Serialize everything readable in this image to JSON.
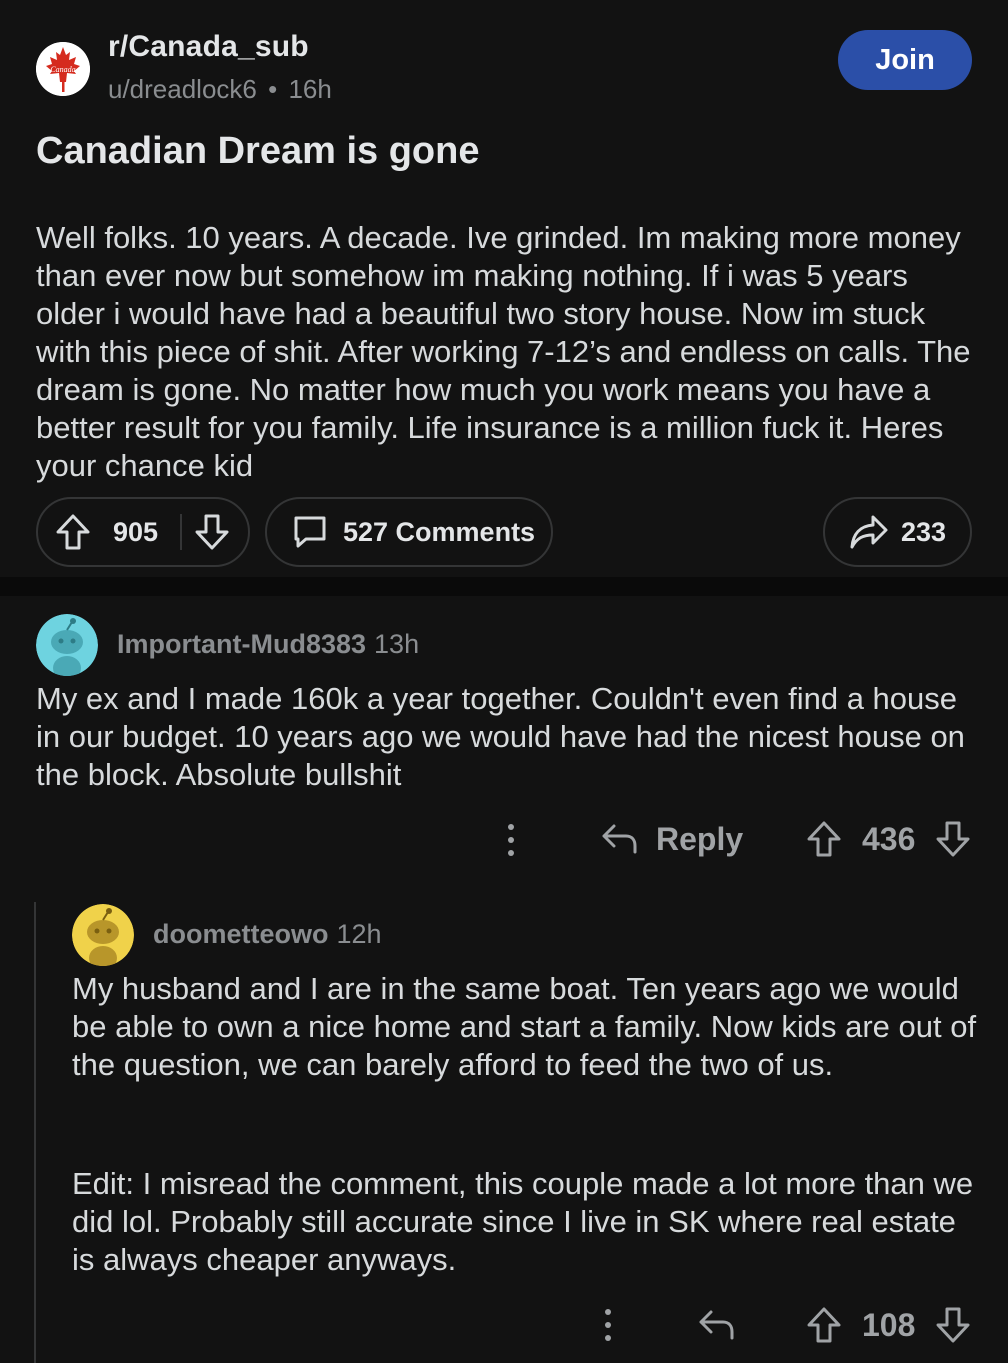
{
  "post": {
    "subreddit": "r/Canada_sub",
    "author": "u/dreadlock6",
    "separator": "•",
    "time": "16h",
    "join_label": "Join",
    "title": "Canadian Dream is gone",
    "body": "Well folks. 10 years. A decade. Ive grinded. Im making more money than ever now but somehow im making nothing. If i was 5 years older i would have had a beautiful two story house. Now im stuck with this piece of shit. After working 7-12’s and endless on calls. The dream is gone. No matter how much you work means you have a better result for you family. Life insurance is a million fuck it. Heres your chance kid",
    "score": "905",
    "comments_label": "527 Comments",
    "shares": "233",
    "icon_text": "Canada",
    "icons": [
      "upvote-icon",
      "downvote-icon",
      "comment-icon",
      "share-icon",
      "maple-leaf-icon"
    ]
  },
  "comments": [
    {
      "author": "Important-Mud8383",
      "time": "13h",
      "body": "My ex and I made 160k a year together. Couldn't even find a house in our budget. 10 years ago we would have had the nicest house on the block. Absolute bullshit",
      "reply_label": "Reply",
      "score": "436",
      "avatar_color": "#6ed3e0"
    },
    {
      "author": "doometteowo",
      "time": "12h",
      "body": "My husband and I are in the same boat. Ten years ago we would be able to own a nice home and start a family. Now kids are out of the question, we can barely afford to feed the two of us.",
      "edit": "Edit: I misread the comment, this couple made a lot more than we did lol. Probably still accurate since I live in SK where real estate is always cheaper anyways.",
      "score": "108",
      "avatar_color": "#f0d24a"
    }
  ],
  "colors": {
    "background": "#121212",
    "join_button": "#2b4fa8",
    "border": "#343536",
    "muted_text": "#8a8d90",
    "canada_red": "#d52b1e"
  }
}
